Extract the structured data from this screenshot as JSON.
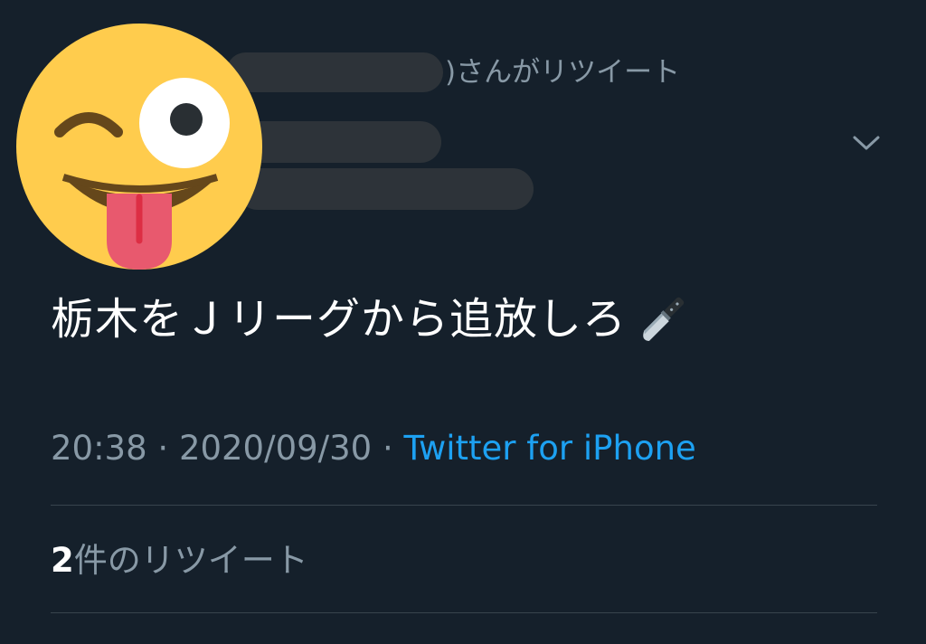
{
  "retweet_header": {
    "text": ")さんがリツイート"
  },
  "tweet": {
    "text": "栃木をＪリーグから追放しろ",
    "emoji": "knife-emoji"
  },
  "meta": {
    "time": "20:38",
    "separator1": " · ",
    "date": "2020/09/30",
    "separator2": " · ",
    "source": "Twitter for iPhone"
  },
  "stats": {
    "retweet_count": "2",
    "retweet_label": "件のリツイート"
  },
  "colors": {
    "background": "#15202b",
    "text_primary": "#ffffff",
    "text_secondary": "#8899a6",
    "link": "#1da1f2",
    "divider": "#38444d"
  },
  "icons": {
    "menu": "chevron-down-icon",
    "avatar": "winking-face-with-tongue-emoji"
  }
}
